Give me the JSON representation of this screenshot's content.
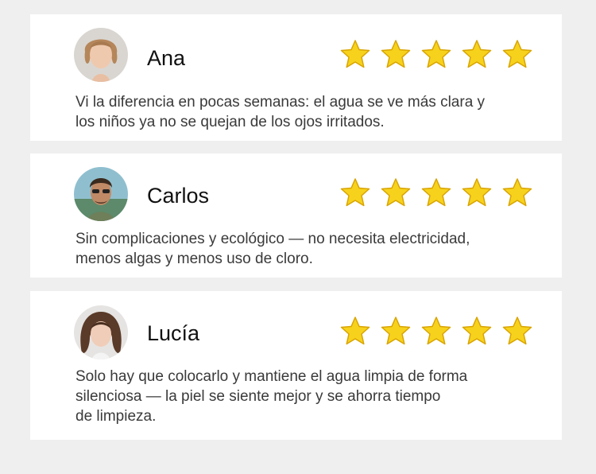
{
  "reviews": [
    {
      "name": "Ana",
      "rating": 5,
      "text": "Vi la diferencia en pocas semanas: el agua se ve más clara y\nlos niños ya no se quejan de los ojos irritados."
    },
    {
      "name": "Carlos",
      "rating": 5,
      "text": "Sin complicaciones y ecológico — no necesita electricidad,\nmenos algas y menos uso de cloro."
    },
    {
      "name": "Lucía",
      "rating": 5,
      "text": "Solo hay que colocarlo y mantiene el agua limpia de forma\nsilenciosa — la piel se siente mejor y se ahorra tiempo\nde limpieza."
    }
  ],
  "colors": {
    "background": "#efefef",
    "card": "#ffffff",
    "star_fill": "#f7d21c",
    "star_outline": "#d9a400"
  }
}
